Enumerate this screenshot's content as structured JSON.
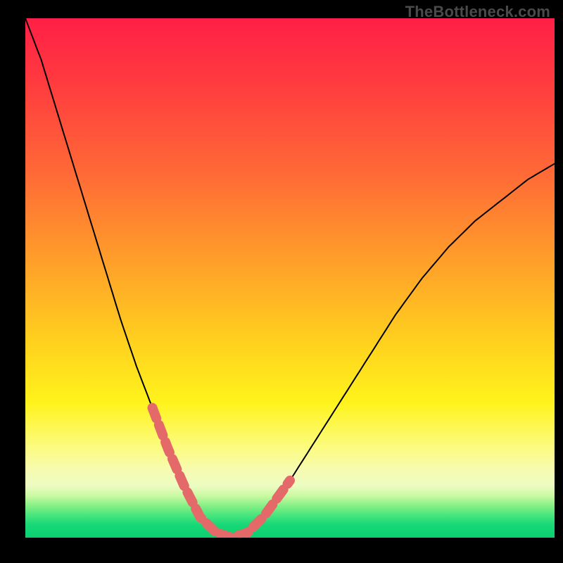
{
  "watermark": "TheBottleneck.com",
  "chart_data": {
    "type": "line",
    "title": "",
    "xlabel": "",
    "ylabel": "",
    "grid": false,
    "legend": false,
    "description": "Single V-shaped bottleneck curve over a vertical red→yellow→green gradient. Curve plunges from top-left, reaches a flat minimum near x≈0.35 at y≈0 (green band), then rises toward the right edge reaching y≈0.72 at x=1. Near the trough and lower arms the curve is overlaid with a thick salmon dashed/beaded stroke.",
    "xlim": [
      0,
      1
    ],
    "ylim": [
      0,
      1
    ],
    "series": [
      {
        "name": "bottleneck-curve",
        "x": [
          0.0,
          0.03,
          0.06,
          0.09,
          0.12,
          0.15,
          0.18,
          0.21,
          0.24,
          0.27,
          0.3,
          0.33,
          0.36,
          0.39,
          0.42,
          0.45,
          0.5,
          0.55,
          0.6,
          0.65,
          0.7,
          0.75,
          0.8,
          0.85,
          0.9,
          0.95,
          1.0
        ],
        "y": [
          1.0,
          0.92,
          0.82,
          0.72,
          0.62,
          0.52,
          0.42,
          0.33,
          0.25,
          0.17,
          0.1,
          0.04,
          0.01,
          0.0,
          0.01,
          0.04,
          0.11,
          0.19,
          0.27,
          0.35,
          0.43,
          0.5,
          0.56,
          0.61,
          0.65,
          0.69,
          0.72
        ]
      }
    ],
    "highlight_segment": {
      "note": "Salmon beaded overlay on the lower portion of the curve",
      "x_start": 0.24,
      "x_end": 0.5,
      "style": "thick-dashed-salmon"
    },
    "background_gradient": {
      "direction": "top-to-bottom",
      "stops": [
        {
          "pos": 0.0,
          "color": "#ff1f46"
        },
        {
          "pos": 0.3,
          "color": "#ff6a36"
        },
        {
          "pos": 0.62,
          "color": "#ffd01e"
        },
        {
          "pos": 0.82,
          "color": "#fcfb78"
        },
        {
          "pos": 0.92,
          "color": "#c8f9a0"
        },
        {
          "pos": 1.0,
          "color": "#0bd070"
        }
      ]
    }
  }
}
